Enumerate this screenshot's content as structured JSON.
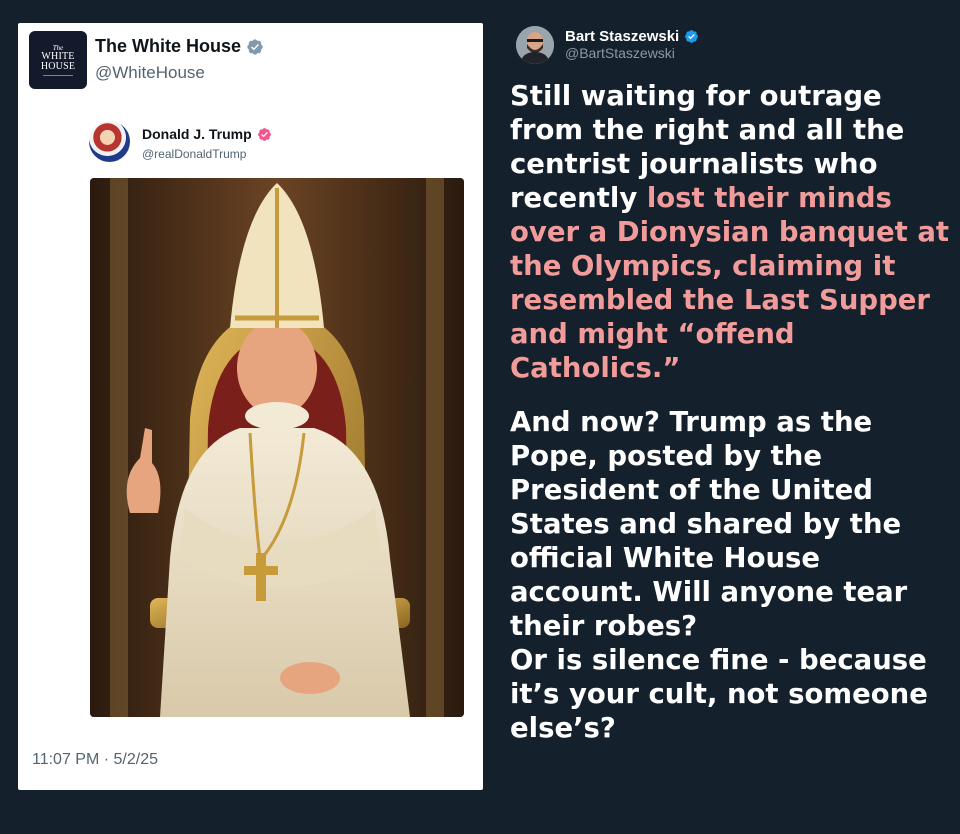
{
  "embedded_post": {
    "logo": {
      "line1": "The",
      "line2": "WHITE",
      "line3": "HOUSE"
    },
    "account_name": "The White House",
    "account_handle": "@WhiteHouse",
    "quoted": {
      "name": "Donald J. Trump",
      "handle": "@realDonaldTrump"
    },
    "timestamp": "11:07 PM · 5/2/25"
  },
  "author": {
    "name": "Bart Staszewski",
    "handle": "@BartStaszewski"
  },
  "post": {
    "p1_before": "Still waiting for outrage from the right and all the centrist journalists who recently ",
    "p1_highlight": "lost their minds over a Dionysian banquet at the Olympics, claiming it resembled the Last Supper and might “offend Catholics.”",
    "p2_line1": "And now? Trump as the Pope, posted by the President of the United States and shared by the official White House account. Will anyone tear their robes?",
    "p2_line2": "Or is silence fine - because it’s your cult, not someone else’s?"
  },
  "colors": {
    "background": "#14202c",
    "highlight": "#f29b9b",
    "verified_blue": "#1d9bf0",
    "verified_gold": "#e3b341",
    "trump_badge": "#f4558f"
  }
}
